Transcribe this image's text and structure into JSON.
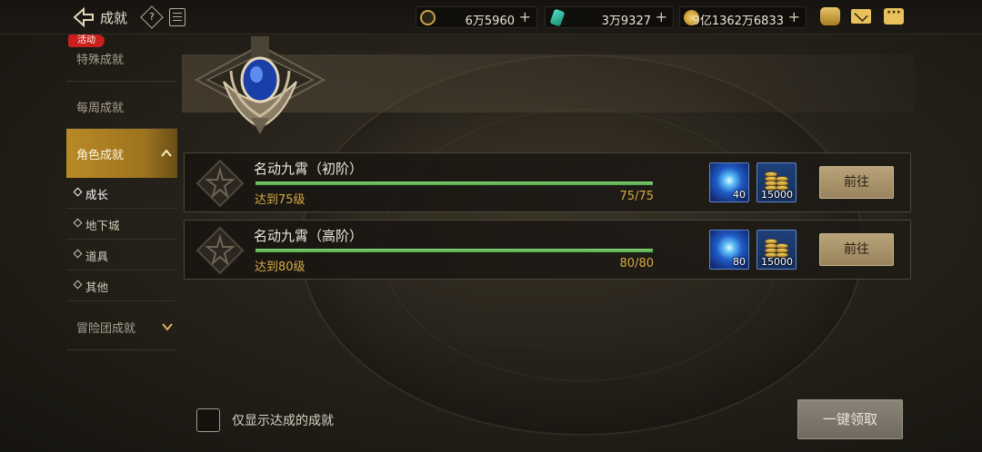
{
  "header": {
    "title": "成就",
    "help_glyph": "?",
    "currencies": [
      {
        "icon": "gold-coin-icon",
        "value": "6万5960"
      },
      {
        "icon": "gem-crystal-icon",
        "value": "3万9327"
      },
      {
        "icon": "coin-icon",
        "value": "9亿1362万6833"
      }
    ],
    "plus": "+"
  },
  "sidebar": {
    "items": [
      {
        "label": "特殊成就",
        "badge": "活动"
      },
      {
        "label": "每周成就"
      },
      {
        "label": "角色成就",
        "expanded": true,
        "sub": [
          {
            "label": "成长",
            "active": true
          },
          {
            "label": "地下城"
          },
          {
            "label": "道具"
          },
          {
            "label": "其他"
          }
        ]
      },
      {
        "label": "冒险团成就"
      }
    ]
  },
  "achievements": [
    {
      "title": "名动九霄（初阶）",
      "requirement": "达到75级",
      "progress_text": "75/75",
      "progress": 1.0,
      "rewards": [
        {
          "icon": "blue-orb-icon",
          "qty": "40"
        },
        {
          "icon": "gold-coins-icon",
          "qty": "15000"
        }
      ],
      "action": "前往"
    },
    {
      "title": "名动九霄（高阶）",
      "requirement": "达到80级",
      "progress_text": "80/80",
      "progress": 1.0,
      "rewards": [
        {
          "icon": "blue-orb-icon",
          "qty": "80"
        },
        {
          "icon": "gold-coins-icon",
          "qty": "15000"
        }
      ],
      "action": "前往"
    }
  ],
  "footer": {
    "filter_label": "仅显示达成的成就",
    "claim_all": "一键领取"
  },
  "colors": {
    "accent": "#b88a26",
    "progress": "#6fc465",
    "highlight_text": "#d7ab45"
  }
}
